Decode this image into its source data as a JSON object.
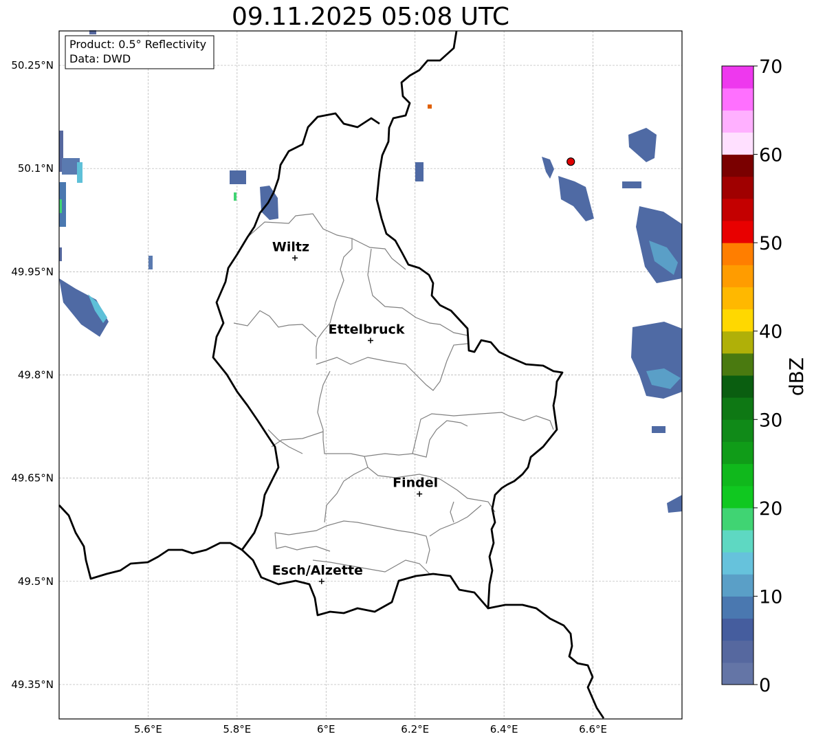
{
  "title": "09.11.2025 05:08 UTC",
  "info_box": {
    "product": "Product: 0.5° Reflectivity",
    "data": "Data: DWD"
  },
  "map": {
    "lon_range": [
      5.4,
      6.8
    ],
    "lat_range": [
      49.3,
      50.3
    ],
    "lon_ticks": [
      {
        "value": 5.6,
        "label": "5.6°E"
      },
      {
        "value": 5.8,
        "label": "5.8°E"
      },
      {
        "value": 6.0,
        "label": "6°E"
      },
      {
        "value": 6.2,
        "label": "6.2°E"
      },
      {
        "value": 6.4,
        "label": "6.4°E"
      },
      {
        "value": 6.6,
        "label": "6.6°E"
      }
    ],
    "lat_ticks": [
      {
        "value": 50.25,
        "label": "50.25°N"
      },
      {
        "value": 50.1,
        "label": "50.1°N"
      },
      {
        "value": 49.95,
        "label": "49.95°N"
      },
      {
        "value": 49.8,
        "label": "49.8°N"
      },
      {
        "value": 49.65,
        "label": "49.65°N"
      },
      {
        "value": 49.5,
        "label": "49.5°N"
      },
      {
        "value": 49.35,
        "label": "49.35°N"
      }
    ],
    "grid": true,
    "cities": [
      {
        "name": "Wiltz",
        "lon": 5.93,
        "lat": 49.97
      },
      {
        "name": "Ettelbruck",
        "lon": 6.1,
        "lat": 49.85
      },
      {
        "name": "Findel",
        "lon": 6.21,
        "lat": 49.627
      },
      {
        "name": "Esch/Alzette",
        "lon": 5.99,
        "lat": 49.5
      }
    ],
    "radar_site": {
      "lon": 6.55,
      "lat": 50.11,
      "color": "#e00000"
    }
  },
  "colorbar": {
    "label": "dBZ",
    "min": 0,
    "max": 70,
    "step": 2.5,
    "tick_labels": [
      "0",
      "10",
      "20",
      "30",
      "40",
      "50",
      "60",
      "70"
    ],
    "colors": [
      "#6475a6",
      "#56689f",
      "#455d9e",
      "#4a78b0",
      "#5a9fc7",
      "#66c2dc",
      "#5ed8c2",
      "#40d473",
      "#10c820",
      "#10b81c",
      "#109c18",
      "#108a18",
      "#0e7814",
      "#0a5e10",
      "#4a7a10",
      "#b0b008",
      "#ffd800",
      "#ffb800",
      "#ff9c00",
      "#ff7e00",
      "#e80000",
      "#c40000",
      "#a00000",
      "#7a0000",
      "#ffe0ff",
      "#ffb0ff",
      "#ff70ff",
      "#ee38ee"
    ]
  }
}
